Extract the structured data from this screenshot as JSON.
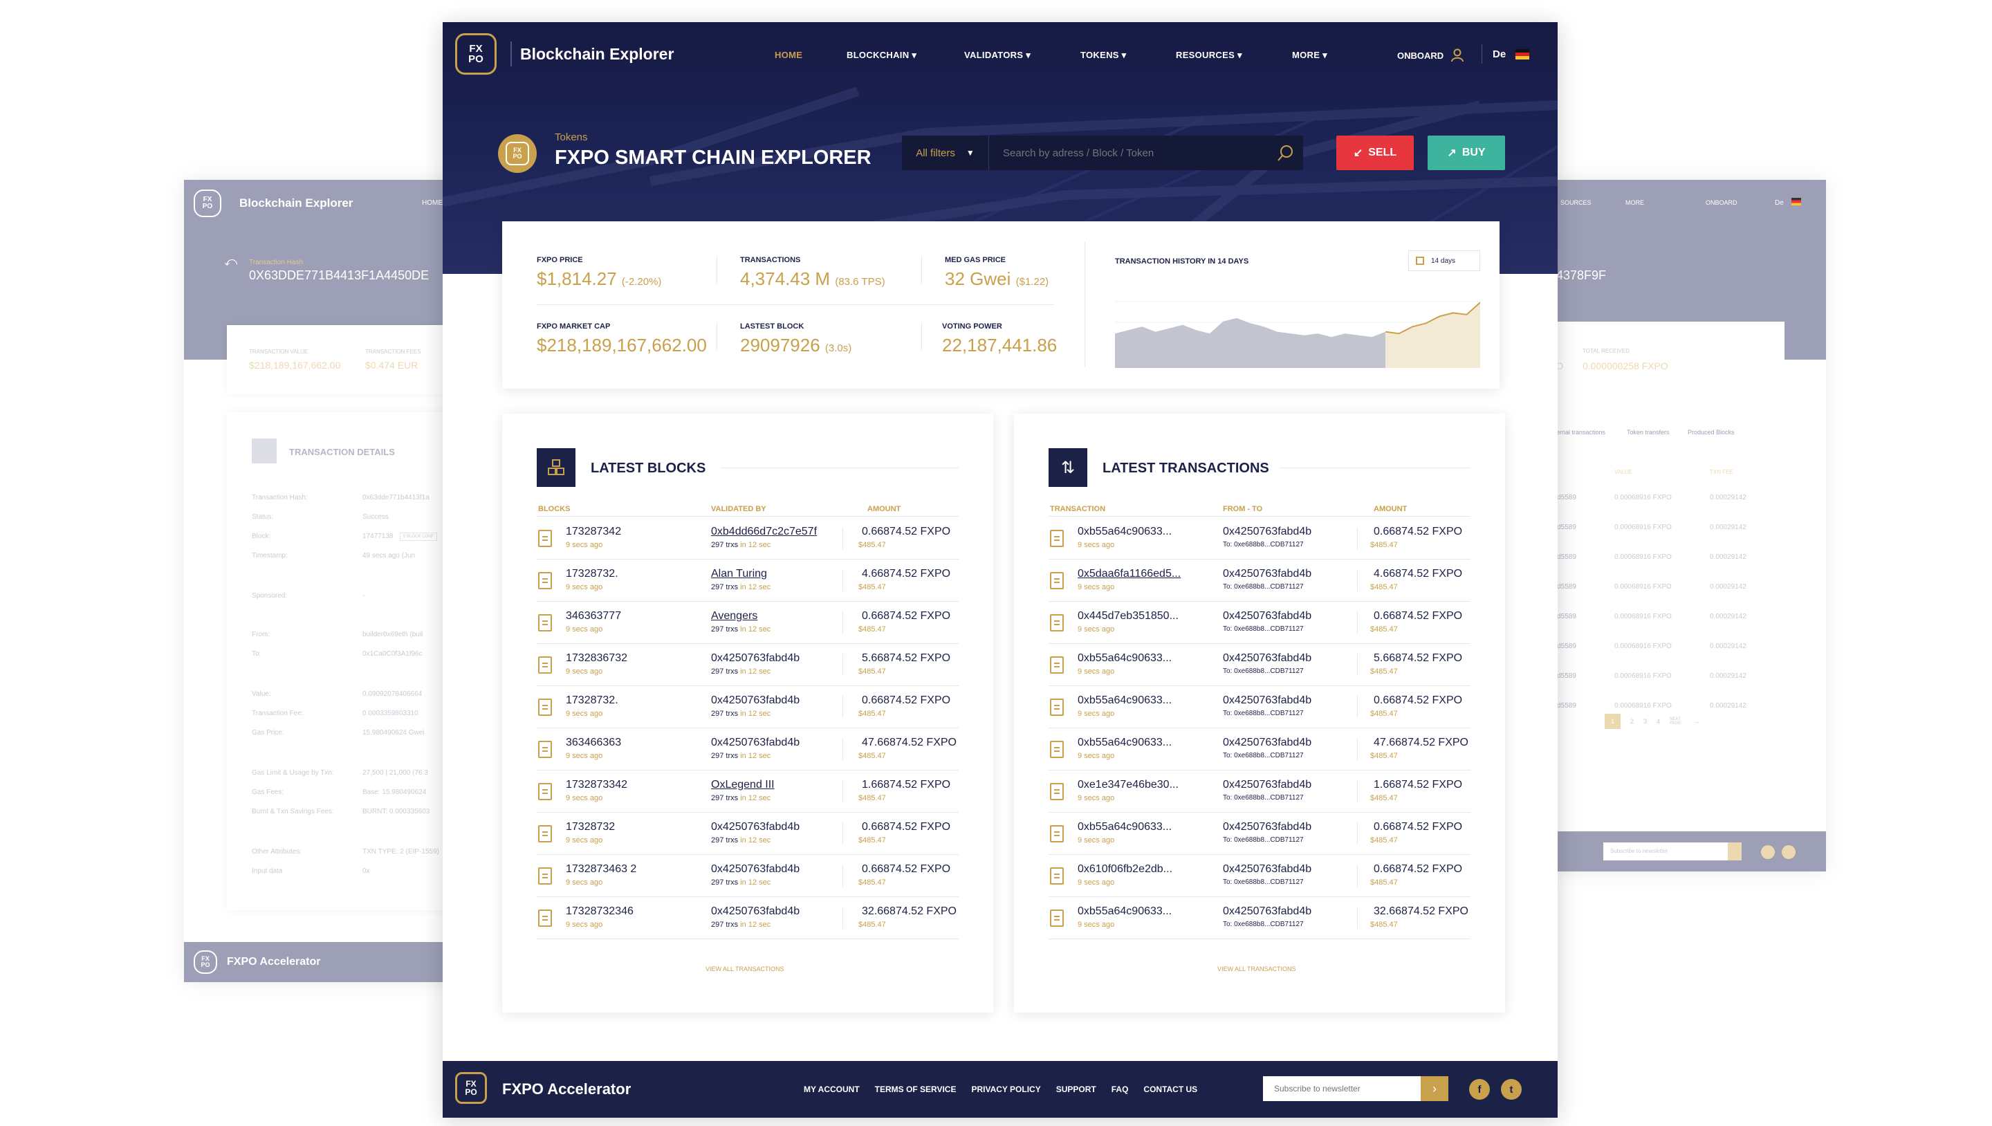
{
  "left_ghost": {
    "brand": "Blockchain Explorer",
    "home_nav": "HOME",
    "hash_label": "Transaction Hash",
    "hash_value": "0X63DDE771B4413F1A4450DE",
    "value_label": "TRANSACTION VALUE",
    "value": "$218,189,167,662.00",
    "fees_label": "TRANSACTION FEES",
    "fees": "$0.474 EUR",
    "details_title": "TRANSACTION DETAILS",
    "rows": [
      {
        "k": "Transaction Hash:",
        "v": "0x63dde771b4413f1a"
      },
      {
        "k": "Status:",
        "v": "Success"
      },
      {
        "k": "Block:",
        "v": "17477138"
      },
      {
        "k": "Timestamp:",
        "v": "49 secs ago (Jun"
      },
      {
        "k": "Sponsored:",
        "v": "-"
      },
      {
        "k": "From:",
        "v": "builder0x69eth (buil"
      },
      {
        "k": "To:",
        "v": "0x1Ca0C0f3A1f96c"
      },
      {
        "k": "Value:",
        "v": "0.09092078406664"
      },
      {
        "k": "Transaction Fee:",
        "v": "0.0003359803310"
      },
      {
        "k": "Gas Price:",
        "v": "15.980490624 Gwei"
      },
      {
        "k": "Gas Limit & Usage by Txn:",
        "v": "27,500 | 21,000 (76.3"
      },
      {
        "k": "Gas Fees:",
        "v": "Base: 15.980490624"
      },
      {
        "k": "Burnt & Txn Savings Fees:",
        "v": "BURNT: 0.000335603"
      },
      {
        "k": "Other Attributes:",
        "v": "TXN TYPE: 2 (EIP-1559)"
      },
      {
        "k": "Input data",
        "v": "0x"
      }
    ],
    "block_badge": "5 BLOCK CONF",
    "footer_brand": "FXPO Accelerator"
  },
  "right_ghost": {
    "nav": [
      "SOURCES",
      "MORE"
    ],
    "onboard": "ONBOARD",
    "lang": "De",
    "hash_tail": "4378F9F",
    "received_label": "TOTAL RECEIVED",
    "received": "0.000000258 FXPO",
    "left_val": "PO",
    "tabs": [
      "Internal transactions",
      "Token transfers",
      "Produced Blocks"
    ],
    "col_hdr": [
      "VALUE",
      "TXN FEE"
    ],
    "rows": [
      {
        "a": "4bd5589",
        "b": "0.00068916 FXPO",
        "c": "0.00029142"
      },
      {
        "a": "4bd5589",
        "b": "0.00068916 FXPO",
        "c": "0.00029142"
      },
      {
        "a": "4bd5589",
        "b": "0.00068916 FXPO",
        "c": "0.00029142"
      },
      {
        "a": "4bd5589",
        "b": "0.00068916 FXPO",
        "c": "0.00029142"
      },
      {
        "a": "4bd5589",
        "b": "0.00068916 FXPO",
        "c": "0.00029142"
      },
      {
        "a": "4bd5589",
        "b": "0.00068916 FXPO",
        "c": "0.00029142"
      },
      {
        "a": "4bd5589",
        "b": "0.00068916 FXPO",
        "c": "0.00029142"
      },
      {
        "a": "4bd5589",
        "b": "0.00068916 FXPO",
        "c": "0.00029142"
      }
    ],
    "pages": [
      "1",
      "2",
      "3",
      "4"
    ],
    "next": "NEXT PAGE",
    "subscribe": "Subscribe to newsletter"
  },
  "header": {
    "logo_text": "FXPO",
    "brand": "Blockchain Explorer",
    "nav": [
      {
        "label": "HOME",
        "active": true
      },
      {
        "label": "BLOCKCHAIN"
      },
      {
        "label": "VALIDATORS"
      },
      {
        "label": "TOKENS"
      },
      {
        "label": "RESOURCES"
      },
      {
        "label": "MORE"
      }
    ],
    "onboard": "ONBOARD",
    "lang": "De"
  },
  "hero": {
    "crumb": "Tokens",
    "title": "FXPO SMART CHAIN EXPLORER",
    "filter": "All filters",
    "search_placeholder": "Search by adress / Block / Token",
    "sell": "SELL",
    "buy": "BUY"
  },
  "stats": {
    "price_label": "FXPO PRICE",
    "price": "$1,814.27",
    "price_change": "(-2.20%)",
    "tx_label": "TRANSACTIONS",
    "tx": "4,374.43 M",
    "tx_sub": "(83.6 TPS)",
    "gas_label": "MED GAS PRICE",
    "gas": "32 Gwei",
    "gas_sub": "($1.22)",
    "cap_label": "FXPO MARKET CAP",
    "cap": "$218,189,167,662.00",
    "block_label": "LASTEST BLOCK",
    "block": "29097926",
    "block_sub": "(3.0s)",
    "vote_label": "VOTING POWER",
    "vote": "22,187,441.86",
    "history_label": "TRANSACTION HISTORY IN 14 DAYS",
    "range": "14 days"
  },
  "chart_data": {
    "type": "area",
    "title": "TRANSACTION HISTORY IN 14 DAYS",
    "x": [
      1,
      2,
      3,
      4,
      5,
      6,
      7,
      8,
      9,
      10,
      11,
      12,
      13,
      14,
      15,
      16,
      17,
      18,
      19,
      20,
      21,
      22,
      23,
      24,
      25,
      26,
      27,
      28
    ],
    "values": [
      20,
      22,
      24,
      21,
      23,
      25,
      22,
      20,
      27,
      29,
      26,
      24,
      21,
      20,
      19,
      20,
      18,
      20,
      19,
      18,
      21,
      20,
      24,
      26,
      30,
      32,
      31,
      38
    ],
    "highlight_from": 20,
    "colors": {
      "base": "#c2c4cf",
      "highlight": "#f3ead6",
      "line": "#c9a04b"
    }
  },
  "blocks": {
    "title": "LATEST BLOCKS",
    "headers": [
      "BLOCKS",
      "VALIDATED BY",
      "AMOUNT"
    ],
    "rows": [
      {
        "id": "173287342",
        "ago": "9 secs ago",
        "by": "0xb4dd66d7c2c7e57f",
        "link": true,
        "txns": "297 trxs",
        "in": "in 12 sec",
        "amt": "0.66874.52 FXPO",
        "usd": "$485.47"
      },
      {
        "id": "17328732.",
        "ago": "9 secs ago",
        "by": "Alan Turing",
        "link": true,
        "txns": "297 trxs",
        "in": "in 12 sec",
        "amt": "4.66874.52 FXPO",
        "usd": "$485.47"
      },
      {
        "id": "346363777",
        "ago": "9 secs ago",
        "by": "Avengers",
        "link": true,
        "txns": "297 trxs",
        "in": "in 12 sec",
        "amt": "0.66874.52 FXPO",
        "usd": "$485.47"
      },
      {
        "id": "1732836732",
        "ago": "9 secs ago",
        "by": "0x4250763fabd4b",
        "link": false,
        "txns": "297 trxs",
        "in": "in 12 sec",
        "amt": "5.66874.52 FXPO",
        "usd": "$485.47"
      },
      {
        "id": "17328732.",
        "ago": "9 secs ago",
        "by": "0x4250763fabd4b",
        "link": false,
        "txns": "297 trxs",
        "in": "in 12 sec",
        "amt": "0.66874.52 FXPO",
        "usd": "$485.47"
      },
      {
        "id": "363466363",
        "ago": "9 secs ago",
        "by": "0x4250763fabd4b",
        "link": false,
        "txns": "297 trxs",
        "in": "in 12 sec",
        "amt": "47.66874.52 FXPO",
        "usd": "$485.47"
      },
      {
        "id": "1732873342",
        "ago": "9 secs ago",
        "by": "OxLegend III",
        "link": true,
        "txns": "297 trxs",
        "in": "in 12 sec",
        "amt": "1.66874.52 FXPO",
        "usd": "$485.47"
      },
      {
        "id": "17328732",
        "ago": "9 secs ago",
        "by": "0x4250763fabd4b",
        "link": false,
        "txns": "297 trxs",
        "in": "in 12 sec",
        "amt": "0.66874.52 FXPO",
        "usd": "$485.47"
      },
      {
        "id": "1732873463 2",
        "ago": "9 secs ago",
        "by": "0x4250763fabd4b",
        "link": false,
        "txns": "297 trxs",
        "in": "in 12 sec",
        "amt": "0.66874.52 FXPO",
        "usd": "$485.47"
      },
      {
        "id": "17328732346",
        "ago": "9 secs ago",
        "by": "0x4250763fabd4b",
        "link": false,
        "txns": "297 trxs",
        "in": "in 12 sec",
        "amt": "32.66874.52 FXPO",
        "usd": "$485.47"
      }
    ],
    "view_all": "VIEW ALL TRANSACTIONS"
  },
  "transactions": {
    "title": "LATEST TRANSACTIONS",
    "headers": [
      "TRANSACTION",
      "FROM - TO",
      "AMOUNT"
    ],
    "rows": [
      {
        "id": "0xb55a64c90633...",
        "ago": "9 secs ago",
        "from": "0x4250763fabd4b",
        "to": "To: 0xe688b8...CDB71127",
        "amt": "0.66874.52 FXPO",
        "usd": "$485.47",
        "link": false
      },
      {
        "id": "0x5daa6fa1166ed5...",
        "ago": "9 secs ago",
        "from": "0x4250763fabd4b",
        "to": "To: 0xe688b8...CDB71127",
        "amt": "4.66874.52 FXPO",
        "usd": "$485.47",
        "link": true
      },
      {
        "id": "0x445d7eb351850...",
        "ago": "9 secs ago",
        "from": "0x4250763fabd4b",
        "to": "To: 0xe688b8...CDB71127",
        "amt": "0.66874.52 FXPO",
        "usd": "$485.47",
        "link": false
      },
      {
        "id": "0xb55a64c90633...",
        "ago": "9 secs ago",
        "from": "0x4250763fabd4b",
        "to": "To: 0xe688b8...CDB71127",
        "amt": "5.66874.52 FXPO",
        "usd": "$485.47",
        "link": false
      },
      {
        "id": "0xb55a64c90633...",
        "ago": "9 secs ago",
        "from": "0x4250763fabd4b",
        "to": "To: 0xe688b8...CDB71127",
        "amt": "0.66874.52 FXPO",
        "usd": "$485.47",
        "link": false
      },
      {
        "id": "0xb55a64c90633...",
        "ago": "9 secs ago",
        "from": "0x4250763fabd4b",
        "to": "To: 0xe688b8...CDB71127",
        "amt": "47.66874.52 FXPO",
        "usd": "$485.47",
        "link": false
      },
      {
        "id": "0xe1e347e46be30...",
        "ago": "9 secs ago",
        "from": "0x4250763fabd4b",
        "to": "To: 0xe688b8...CDB71127",
        "amt": "1.66874.52 FXPO",
        "usd": "$485.47",
        "link": false
      },
      {
        "id": "0xb55a64c90633...",
        "ago": "9 secs ago",
        "from": "0x4250763fabd4b",
        "to": "To: 0xe688b8...CDB71127",
        "amt": "0.66874.52 FXPO",
        "usd": "$485.47",
        "link": false
      },
      {
        "id": "0x610f06fb2e2db...",
        "ago": "9 secs ago",
        "from": "0x4250763fabd4b",
        "to": "To: 0xe688b8...CDB71127",
        "amt": "0.66874.52 FXPO",
        "usd": "$485.47",
        "link": false
      },
      {
        "id": "0xb55a64c90633...",
        "ago": "9 secs ago",
        "from": "0x4250763fabd4b",
        "to": "To: 0xe688b8...CDB71127",
        "amt": "32.66874.52 FXPO",
        "usd": "$485.47",
        "link": false
      }
    ],
    "view_all": "VIEW ALL TRANSACTIONS"
  },
  "footer": {
    "brand": "FXPO Accelerator",
    "links": [
      "MY ACCOUNT",
      "TERMS OF SERVICE",
      "PRIVACY POLICY",
      "SUPPORT",
      "FAQ",
      "CONTACT US"
    ],
    "subscribe_placeholder": "Subscribe to newsletter",
    "social": [
      "f",
      "t"
    ]
  },
  "colors": {
    "navy": "#1c2147",
    "gold": "#c9a04b",
    "sell": "#e8363f",
    "buy": "#3eb39d"
  }
}
